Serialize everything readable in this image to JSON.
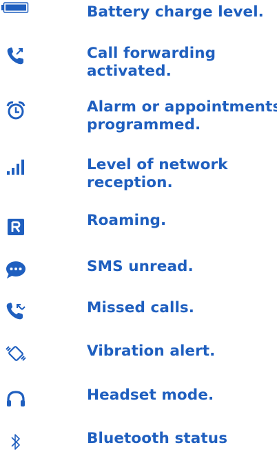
{
  "legend": {
    "items": [
      {
        "icon": "battery-icon",
        "label": "Battery charge level."
      },
      {
        "icon": "call-forwarding-icon",
        "label": "Call forwarding activated."
      },
      {
        "icon": "alarm-clock-icon",
        "label": "Alarm or appointments programmed."
      },
      {
        "icon": "signal-bars-icon",
        "label": "Level of network reception."
      },
      {
        "icon": "roaming-icon",
        "label": "Roaming."
      },
      {
        "icon": "sms-icon",
        "label": "SMS unread."
      },
      {
        "icon": "missed-call-icon",
        "label": "Missed calls."
      },
      {
        "icon": "vibration-icon",
        "label": "Vibration alert."
      },
      {
        "icon": "headset-icon",
        "label": "Headset mode."
      },
      {
        "icon": "bluetooth-icon",
        "label": "Bluetooth status"
      }
    ]
  },
  "colors": {
    "text": "#1f5fbf",
    "icon": "#1f5fbf"
  }
}
